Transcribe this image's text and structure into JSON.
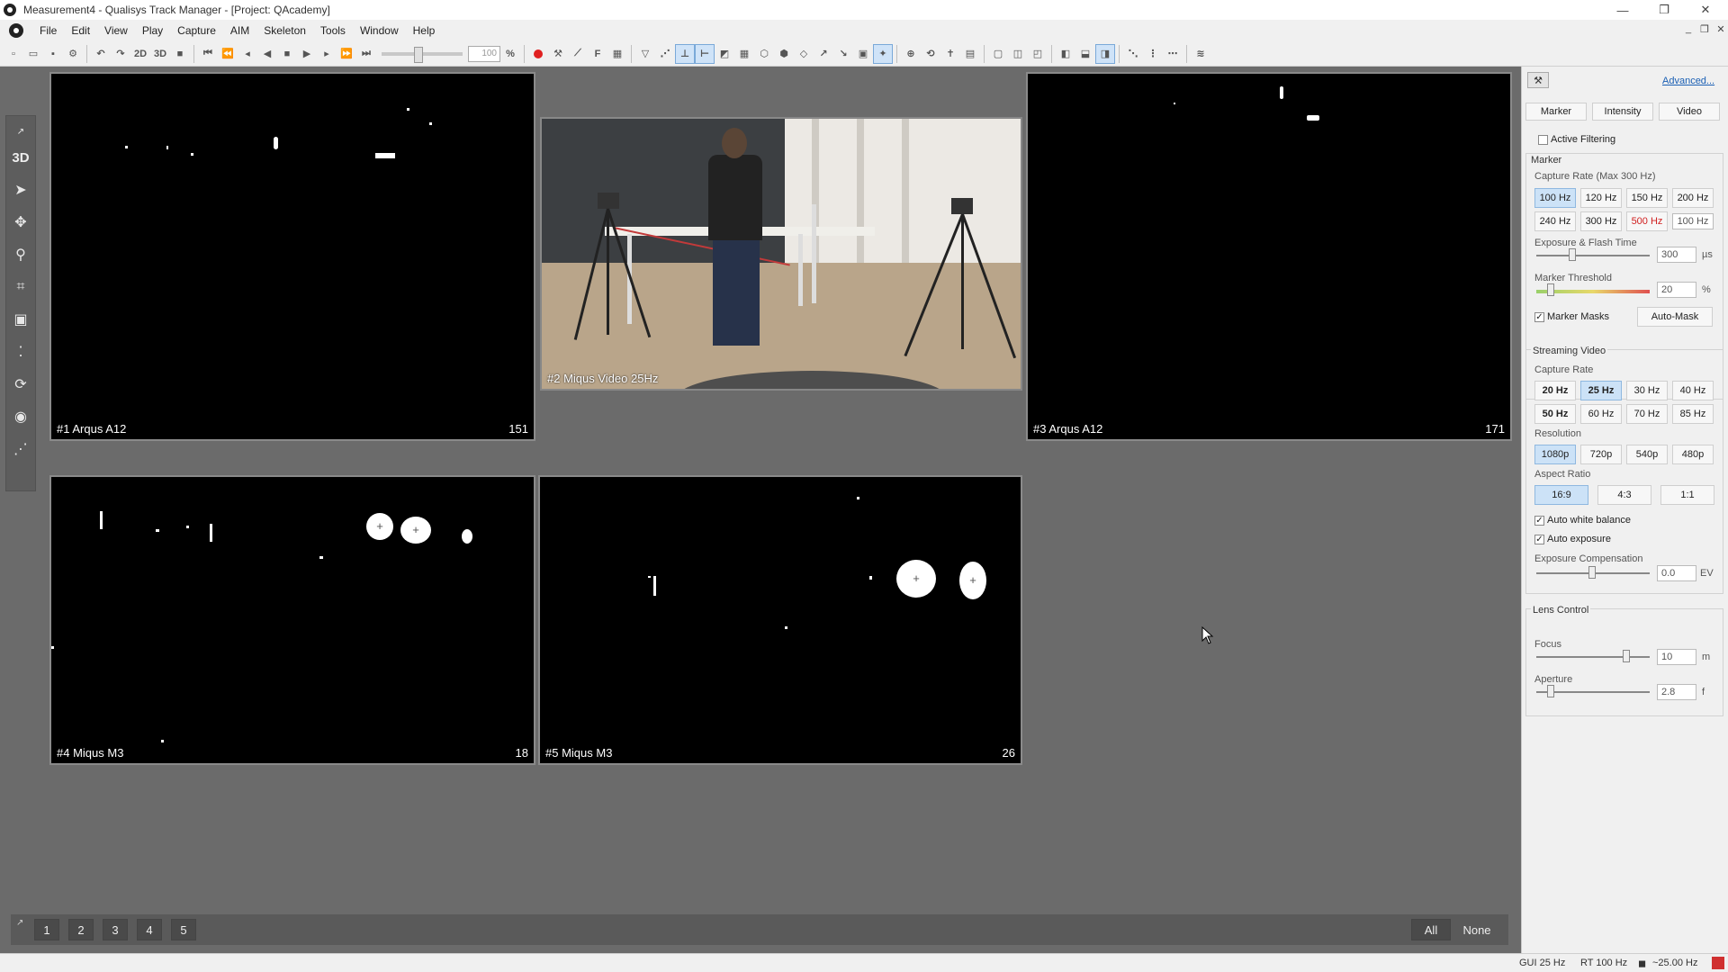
{
  "window": {
    "title": "Measurement4 - Qualisys Track Manager - [Project: QAcademy]",
    "minimize_icon": "minimize-icon",
    "maximize_icon": "restore-icon",
    "close_icon": "close-icon"
  },
  "menu": [
    "File",
    "Edit",
    "View",
    "Play",
    "Capture",
    "AIM",
    "Skeleton",
    "Tools",
    "Window",
    "Help"
  ],
  "toolbar": {
    "mode_2d": "2D",
    "mode_3d": "3D",
    "speed_value": "100",
    "speed_unit": "%"
  },
  "left_tools": {
    "threed_label": "3D",
    "icons": [
      "select-arrow-icon",
      "move-icon",
      "zoom-icon",
      "crop-icon",
      "mask-icon",
      "bone-icon",
      "rotate-icon",
      "circle-icon",
      "trajectory-icon"
    ]
  },
  "views": [
    {
      "label": "#1 Arqus A12",
      "count": "151"
    },
    {
      "label": "#2 Miqus Video 25Hz",
      "count": ""
    },
    {
      "label": "#3 Arqus A12",
      "count": "171"
    },
    {
      "label": "#4 Miqus M3",
      "count": "18"
    },
    {
      "label": "#5 Miqus M3",
      "count": "26"
    }
  ],
  "pages": [
    "1",
    "2",
    "3",
    "4",
    "5"
  ],
  "page_all": "All",
  "page_none": "None",
  "panel": {
    "advanced_link": "Advanced...",
    "tabs": [
      "Marker",
      "Intensity",
      "Video"
    ],
    "active_filtering": "Active Filtering",
    "marker_section": "Marker",
    "capture_rate_label": "Capture Rate (Max 300 Hz)",
    "marker_rates": [
      "100 Hz",
      "120 Hz",
      "150 Hz",
      "200 Hz",
      "240 Hz",
      "300 Hz",
      "500 Hz",
      "100 Hz"
    ],
    "exposure_label": "Exposure & Flash Time",
    "exposure_value": "300",
    "exposure_unit": "µs",
    "threshold_label": "Marker Threshold",
    "threshold_value": "20",
    "threshold_unit": "%",
    "marker_masks": "Marker Masks",
    "auto_mask": "Auto-Mask",
    "streaming_section": "Streaming Video",
    "stream_capture_rate_label": "Capture Rate",
    "stream_rates": [
      "20 Hz",
      "25 Hz",
      "30 Hz",
      "40 Hz",
      "50 Hz",
      "60 Hz",
      "70 Hz",
      "85 Hz"
    ],
    "resolution_label": "Resolution",
    "resolutions": [
      "1080p",
      "720p",
      "540p",
      "480p"
    ],
    "aspect_label": "Aspect Ratio",
    "aspects": [
      "16:9",
      "4:3",
      "1:1"
    ],
    "auto_white_balance": "Auto white balance",
    "auto_exposure": "Auto exposure",
    "exp_comp_label": "Exposure Compensation",
    "exp_comp_value": "0.0",
    "exp_comp_unit": "EV",
    "lens_section": "Lens Control",
    "focus_label": "Focus",
    "focus_value": "10",
    "focus_unit": "m",
    "aperture_label": "Aperture",
    "aperture_value": "2.8",
    "aperture_unit": "f"
  },
  "status": {
    "gui": "GUI 25 Hz",
    "rt": "RT 100 Hz",
    "rate": "~25.00 Hz"
  },
  "colors": {
    "viewport_bg": "#6b6b6b",
    "selected_button": "#cce2f7",
    "warning_red": "#d02020"
  }
}
